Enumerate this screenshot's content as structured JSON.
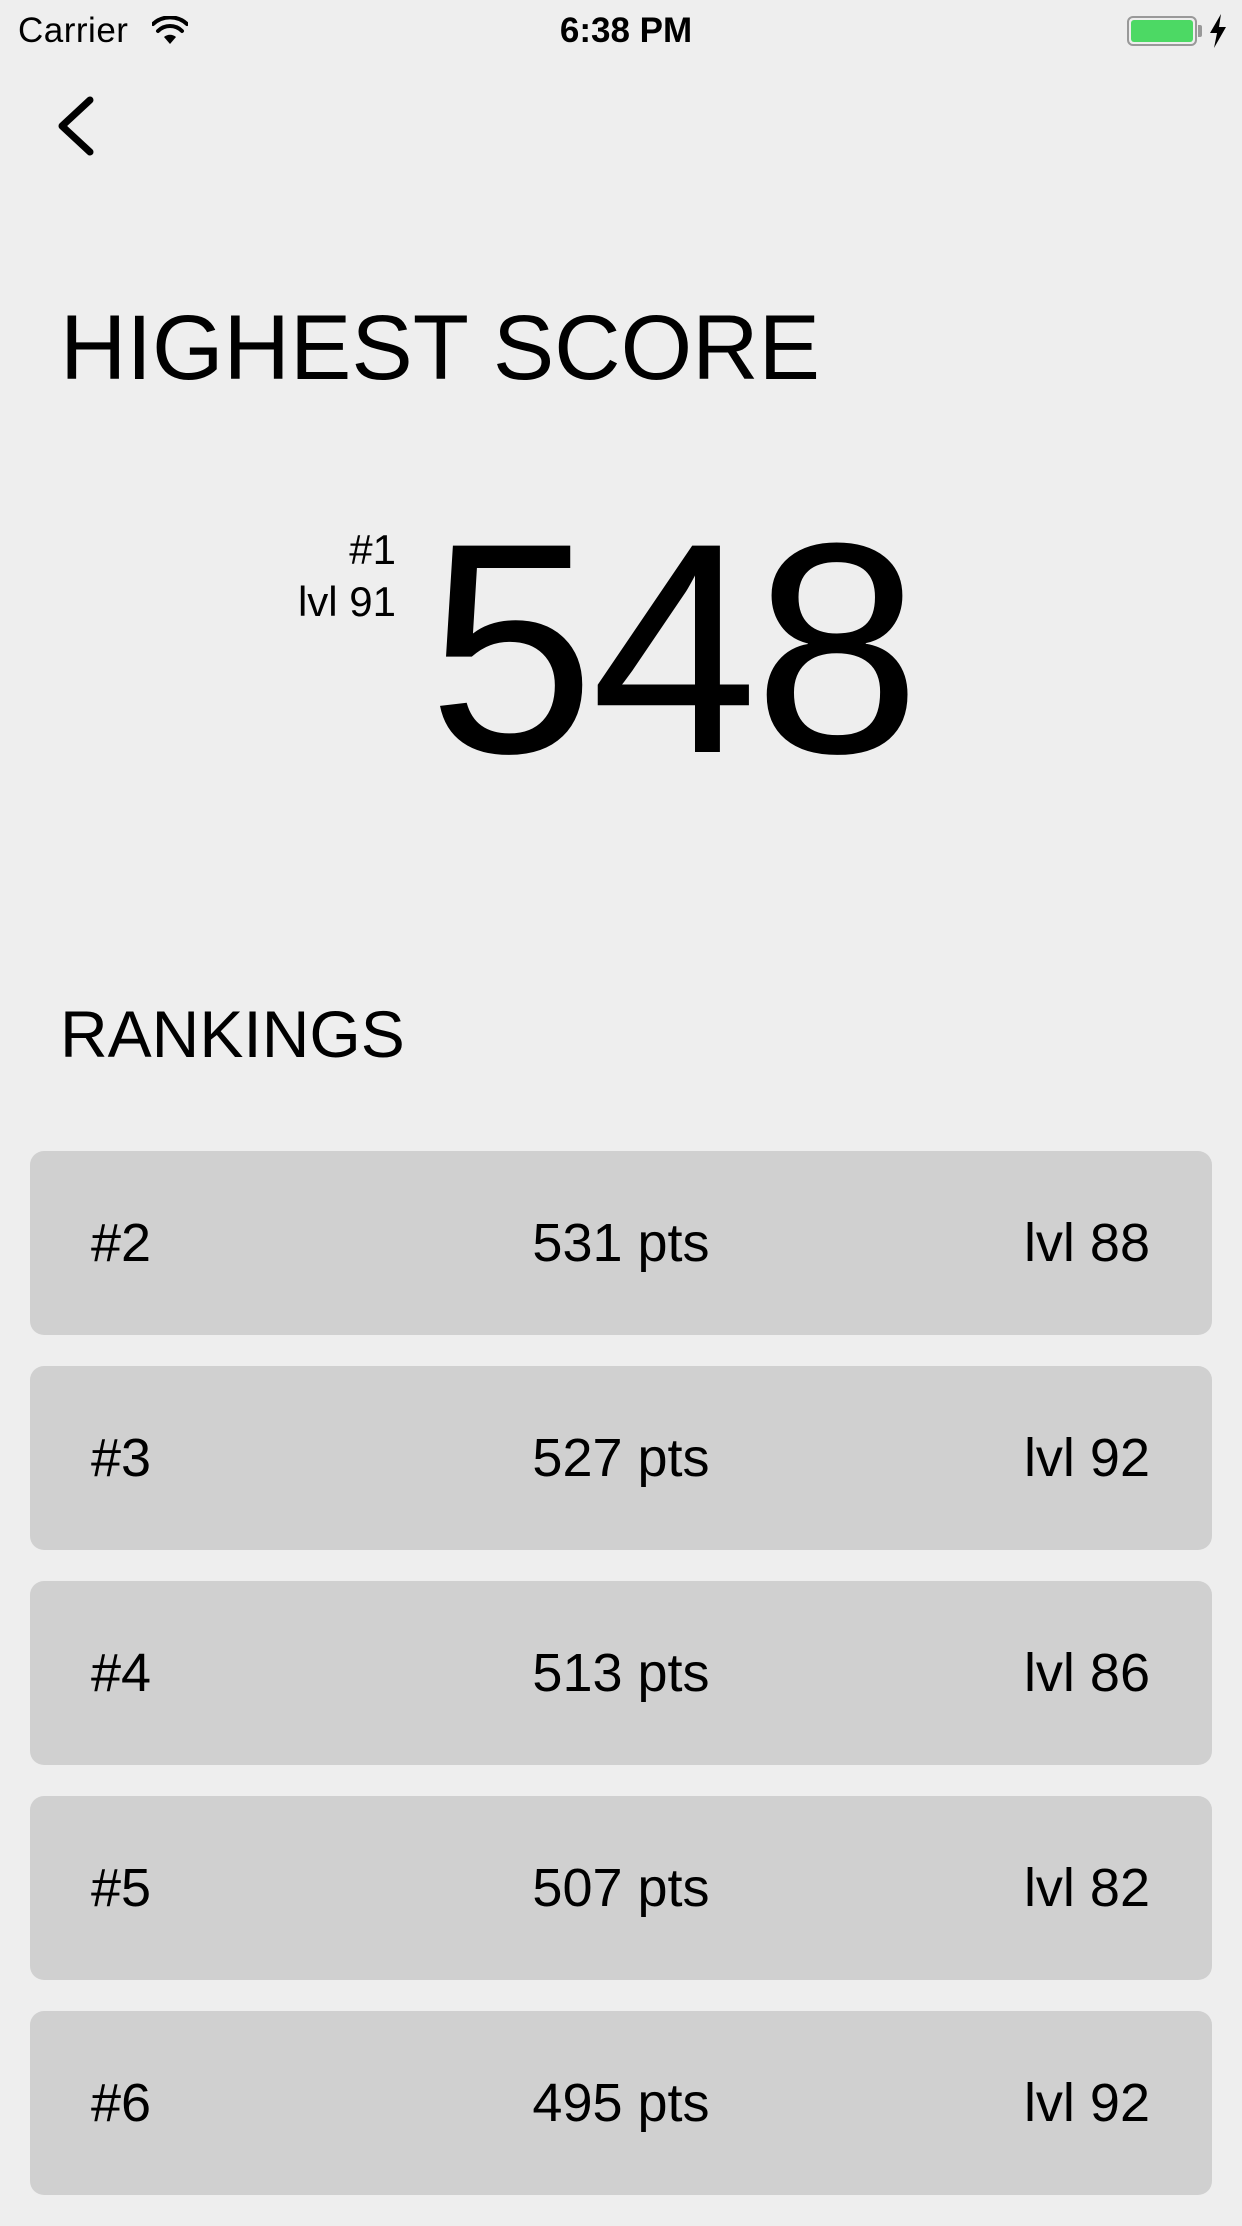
{
  "status_bar": {
    "carrier": "Carrier",
    "time": "6:38 PM",
    "battery_color": "#4cd964"
  },
  "nav": {
    "back_icon": "chevron-left-icon"
  },
  "highest_score": {
    "title": "HIGHEST SCORE",
    "rank": "#1",
    "level": "lvl 91",
    "score": "548"
  },
  "rankings": {
    "title": "RANKINGS",
    "rows": [
      {
        "rank": "#2",
        "points": "531 pts",
        "level": "lvl 88"
      },
      {
        "rank": "#3",
        "points": "527 pts",
        "level": "lvl 92"
      },
      {
        "rank": "#4",
        "points": "513 pts",
        "level": "lvl 86"
      },
      {
        "rank": "#5",
        "points": "507 pts",
        "level": "lvl 82"
      },
      {
        "rank": "#6",
        "points": "495 pts",
        "level": "lvl 92"
      }
    ]
  },
  "colors": {
    "background": "#eeeeee",
    "row_background": "#d0d0d0"
  }
}
